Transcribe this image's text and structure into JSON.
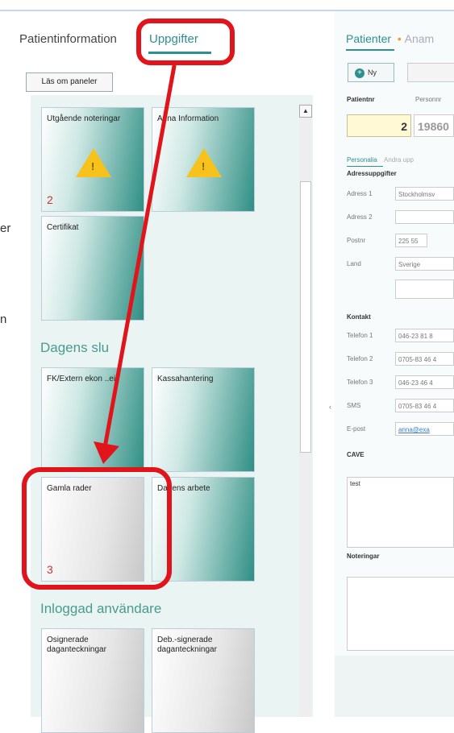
{
  "left_edge": {
    "line1": "er",
    "line2": "n"
  },
  "left_tabs": {
    "patientinfo": "Patientinformation",
    "uppgifter": "Uppgifter"
  },
  "toolbar": {
    "lasom_label": "Läs om paneler"
  },
  "tiles_top": [
    {
      "label": "Utgående noteringar",
      "count": "2"
    },
    {
      "label": "Anna Information",
      "count": ""
    },
    {
      "label": "Certifikat",
      "count": ""
    }
  ],
  "section_dagens": "Dagens slu",
  "tiles_dagens": [
    {
      "label": "FK/Extern ekon ..ei",
      "count": ""
    },
    {
      "label": "Kassahantering",
      "count": ""
    },
    {
      "label": "Gamla rader",
      "count": "3"
    },
    {
      "label": "Dagens arbete",
      "count": ""
    }
  ],
  "section_inloggad": "Inloggad användare",
  "tiles_inloggad": [
    {
      "label": "Osignerade daganteckningar"
    },
    {
      "label": "Deb.-signerade daganteckningar"
    }
  ],
  "right": {
    "tab_patienter": "Patienter",
    "tab_anam": "Anam",
    "ny_label": "Ny",
    "patientnr_label": "Patientnr",
    "personnr_label": "Personnr",
    "patientnr_value": "2",
    "personnr_value": "19860",
    "subtab_personalia": "Personalia",
    "subtab_andra": "Andra upp",
    "adress_header": "Adressuppgifter",
    "adress1_label": "Adress 1",
    "adress1_value": "Stockholmsv",
    "adress2_label": "Adress 2",
    "adress2_value": "",
    "postnr_label": "Postnr",
    "postnr_value": "225 55",
    "land_label": "Land",
    "land_value": "Sverige",
    "kontakt_header": "Kontakt",
    "telefon1_label": "Telefon 1",
    "telefon1_value": "046-23 81 8",
    "telefon2_label": "Telefon 2",
    "telefon2_value": "0705-83 46 4",
    "telefon3_label": "Telefon 3",
    "telefon3_value": "046-23 46 4",
    "sms_label": "SMS",
    "sms_value": "0705-83 46 4",
    "epost_label": "E-post",
    "epost_value": "anna@exa",
    "cave_label": "CAVE",
    "cave_value": "test",
    "noteringar_label": "Noteringar"
  },
  "colors": {
    "accent": "#2e8f8f",
    "annotation_red": "#e0141a",
    "warning_yellow": "#f6c21b",
    "count_red": "#cc3333"
  },
  "icons": {
    "warning": "warning-triangle-icon",
    "plus": "plus-circle-icon",
    "scroll_up": "chevron-up-icon"
  }
}
